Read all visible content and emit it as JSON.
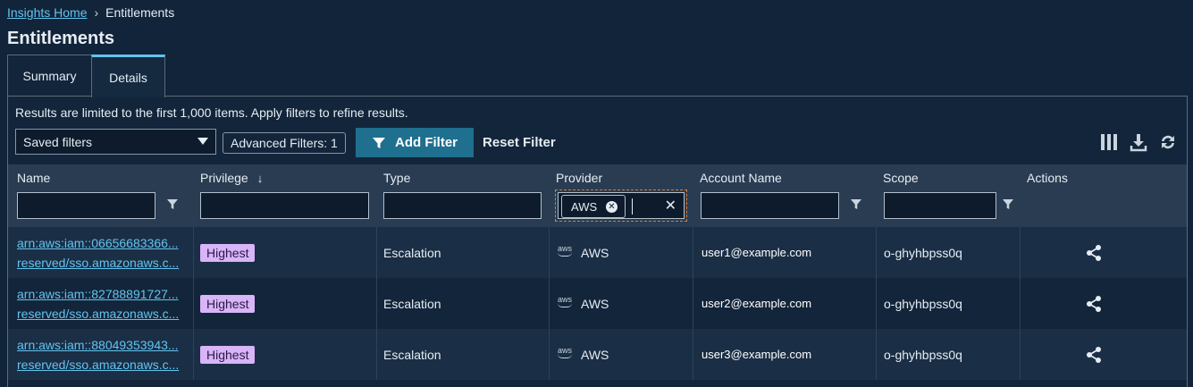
{
  "breadcrumb": {
    "home": "Insights Home",
    "current": "Entitlements"
  },
  "page": {
    "title": "Entitlements"
  },
  "tabs": [
    {
      "label": "Summary",
      "active": false
    },
    {
      "label": "Details",
      "active": true
    }
  ],
  "notice": "Results are limited to the first 1,000 items. Apply filters to refine results.",
  "toolbar": {
    "saved_filters": "Saved filters",
    "advanced_filters": "Advanced Filters: 1",
    "add_filter": "Add Filter",
    "reset_filter": "Reset Filter",
    "icons": [
      "columns-icon",
      "download-icon",
      "refresh-icon"
    ]
  },
  "columns": [
    {
      "label": "Name"
    },
    {
      "label": "Privilege",
      "sort": "descending"
    },
    {
      "label": "Type"
    },
    {
      "label": "Provider"
    },
    {
      "label": "Account Name"
    },
    {
      "label": "Scope"
    },
    {
      "label": "Actions"
    }
  ],
  "provider_filter": {
    "chip": "AWS"
  },
  "rows": [
    {
      "name_line1": "arn:aws:iam::06656683366...",
      "name_line2": "reserved/sso.amazonaws.c...",
      "privilege": "Highest",
      "type": "Escalation",
      "provider": "AWS",
      "account": "user1@example.com",
      "scope": "o-ghyhbpss0q"
    },
    {
      "name_line1": "arn:aws:iam::82788891727...",
      "name_line2": "reserved/sso.amazonaws.c...",
      "privilege": "Highest",
      "type": "Escalation",
      "provider": "AWS",
      "account": "user2@example.com",
      "scope": "o-ghyhbpss0q"
    },
    {
      "name_line1": "arn:aws:iam::88049353943...",
      "name_line2": "reserved/sso.amazonaws.c...",
      "privilege": "Highest",
      "type": "Escalation",
      "provider": "AWS",
      "account": "user3@example.com",
      "scope": "o-ghyhbpss0q"
    }
  ],
  "colors": {
    "background": "#12243a",
    "accent": "#63c3ee",
    "primary_button": "#1f6f8f",
    "badge": "#d8b4f8",
    "header": "#293c52"
  }
}
